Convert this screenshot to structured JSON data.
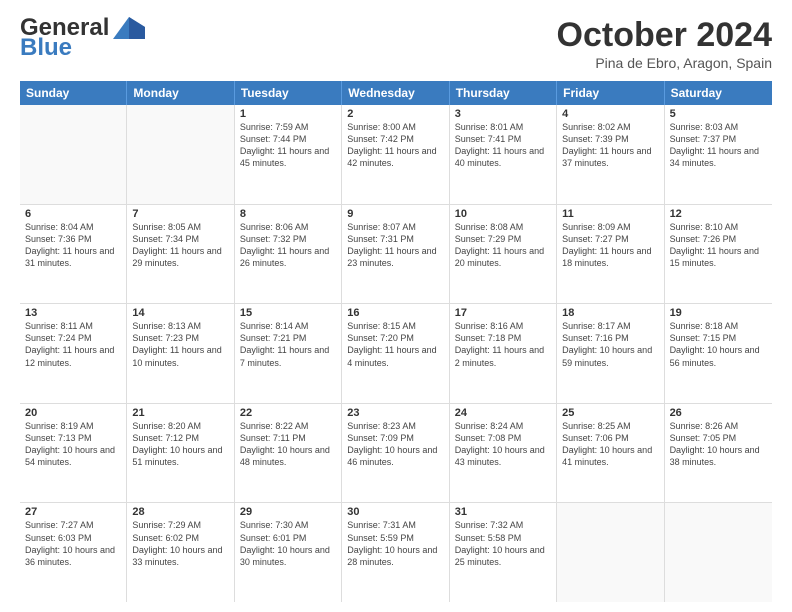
{
  "header": {
    "logo_general": "General",
    "logo_blue": "Blue",
    "month_title": "October 2024",
    "location": "Pina de Ebro, Aragon, Spain"
  },
  "days_of_week": [
    "Sunday",
    "Monday",
    "Tuesday",
    "Wednesday",
    "Thursday",
    "Friday",
    "Saturday"
  ],
  "weeks": [
    [
      {
        "day": "",
        "sunrise": "",
        "sunset": "",
        "daylight": "",
        "empty": true
      },
      {
        "day": "",
        "sunrise": "",
        "sunset": "",
        "daylight": "",
        "empty": true
      },
      {
        "day": "1",
        "sunrise": "Sunrise: 7:59 AM",
        "sunset": "Sunset: 7:44 PM",
        "daylight": "Daylight: 11 hours and 45 minutes."
      },
      {
        "day": "2",
        "sunrise": "Sunrise: 8:00 AM",
        "sunset": "Sunset: 7:42 PM",
        "daylight": "Daylight: 11 hours and 42 minutes."
      },
      {
        "day": "3",
        "sunrise": "Sunrise: 8:01 AM",
        "sunset": "Sunset: 7:41 PM",
        "daylight": "Daylight: 11 hours and 40 minutes."
      },
      {
        "day": "4",
        "sunrise": "Sunrise: 8:02 AM",
        "sunset": "Sunset: 7:39 PM",
        "daylight": "Daylight: 11 hours and 37 minutes."
      },
      {
        "day": "5",
        "sunrise": "Sunrise: 8:03 AM",
        "sunset": "Sunset: 7:37 PM",
        "daylight": "Daylight: 11 hours and 34 minutes."
      }
    ],
    [
      {
        "day": "6",
        "sunrise": "Sunrise: 8:04 AM",
        "sunset": "Sunset: 7:36 PM",
        "daylight": "Daylight: 11 hours and 31 minutes."
      },
      {
        "day": "7",
        "sunrise": "Sunrise: 8:05 AM",
        "sunset": "Sunset: 7:34 PM",
        "daylight": "Daylight: 11 hours and 29 minutes."
      },
      {
        "day": "8",
        "sunrise": "Sunrise: 8:06 AM",
        "sunset": "Sunset: 7:32 PM",
        "daylight": "Daylight: 11 hours and 26 minutes."
      },
      {
        "day": "9",
        "sunrise": "Sunrise: 8:07 AM",
        "sunset": "Sunset: 7:31 PM",
        "daylight": "Daylight: 11 hours and 23 minutes."
      },
      {
        "day": "10",
        "sunrise": "Sunrise: 8:08 AM",
        "sunset": "Sunset: 7:29 PM",
        "daylight": "Daylight: 11 hours and 20 minutes."
      },
      {
        "day": "11",
        "sunrise": "Sunrise: 8:09 AM",
        "sunset": "Sunset: 7:27 PM",
        "daylight": "Daylight: 11 hours and 18 minutes."
      },
      {
        "day": "12",
        "sunrise": "Sunrise: 8:10 AM",
        "sunset": "Sunset: 7:26 PM",
        "daylight": "Daylight: 11 hours and 15 minutes."
      }
    ],
    [
      {
        "day": "13",
        "sunrise": "Sunrise: 8:11 AM",
        "sunset": "Sunset: 7:24 PM",
        "daylight": "Daylight: 11 hours and 12 minutes."
      },
      {
        "day": "14",
        "sunrise": "Sunrise: 8:13 AM",
        "sunset": "Sunset: 7:23 PM",
        "daylight": "Daylight: 11 hours and 10 minutes."
      },
      {
        "day": "15",
        "sunrise": "Sunrise: 8:14 AM",
        "sunset": "Sunset: 7:21 PM",
        "daylight": "Daylight: 11 hours and 7 minutes."
      },
      {
        "day": "16",
        "sunrise": "Sunrise: 8:15 AM",
        "sunset": "Sunset: 7:20 PM",
        "daylight": "Daylight: 11 hours and 4 minutes."
      },
      {
        "day": "17",
        "sunrise": "Sunrise: 8:16 AM",
        "sunset": "Sunset: 7:18 PM",
        "daylight": "Daylight: 11 hours and 2 minutes."
      },
      {
        "day": "18",
        "sunrise": "Sunrise: 8:17 AM",
        "sunset": "Sunset: 7:16 PM",
        "daylight": "Daylight: 10 hours and 59 minutes."
      },
      {
        "day": "19",
        "sunrise": "Sunrise: 8:18 AM",
        "sunset": "Sunset: 7:15 PM",
        "daylight": "Daylight: 10 hours and 56 minutes."
      }
    ],
    [
      {
        "day": "20",
        "sunrise": "Sunrise: 8:19 AM",
        "sunset": "Sunset: 7:13 PM",
        "daylight": "Daylight: 10 hours and 54 minutes."
      },
      {
        "day": "21",
        "sunrise": "Sunrise: 8:20 AM",
        "sunset": "Sunset: 7:12 PM",
        "daylight": "Daylight: 10 hours and 51 minutes."
      },
      {
        "day": "22",
        "sunrise": "Sunrise: 8:22 AM",
        "sunset": "Sunset: 7:11 PM",
        "daylight": "Daylight: 10 hours and 48 minutes."
      },
      {
        "day": "23",
        "sunrise": "Sunrise: 8:23 AM",
        "sunset": "Sunset: 7:09 PM",
        "daylight": "Daylight: 10 hours and 46 minutes."
      },
      {
        "day": "24",
        "sunrise": "Sunrise: 8:24 AM",
        "sunset": "Sunset: 7:08 PM",
        "daylight": "Daylight: 10 hours and 43 minutes."
      },
      {
        "day": "25",
        "sunrise": "Sunrise: 8:25 AM",
        "sunset": "Sunset: 7:06 PM",
        "daylight": "Daylight: 10 hours and 41 minutes."
      },
      {
        "day": "26",
        "sunrise": "Sunrise: 8:26 AM",
        "sunset": "Sunset: 7:05 PM",
        "daylight": "Daylight: 10 hours and 38 minutes."
      }
    ],
    [
      {
        "day": "27",
        "sunrise": "Sunrise: 7:27 AM",
        "sunset": "Sunset: 6:03 PM",
        "daylight": "Daylight: 10 hours and 36 minutes."
      },
      {
        "day": "28",
        "sunrise": "Sunrise: 7:29 AM",
        "sunset": "Sunset: 6:02 PM",
        "daylight": "Daylight: 10 hours and 33 minutes."
      },
      {
        "day": "29",
        "sunrise": "Sunrise: 7:30 AM",
        "sunset": "Sunset: 6:01 PM",
        "daylight": "Daylight: 10 hours and 30 minutes."
      },
      {
        "day": "30",
        "sunrise": "Sunrise: 7:31 AM",
        "sunset": "Sunset: 5:59 PM",
        "daylight": "Daylight: 10 hours and 28 minutes."
      },
      {
        "day": "31",
        "sunrise": "Sunrise: 7:32 AM",
        "sunset": "Sunset: 5:58 PM",
        "daylight": "Daylight: 10 hours and 25 minutes."
      },
      {
        "day": "",
        "sunrise": "",
        "sunset": "",
        "daylight": "",
        "empty": true
      },
      {
        "day": "",
        "sunrise": "",
        "sunset": "",
        "daylight": "",
        "empty": true
      }
    ]
  ]
}
